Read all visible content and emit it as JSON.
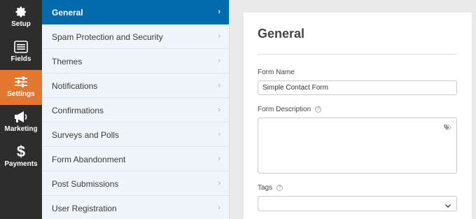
{
  "rail": {
    "items": [
      {
        "label": "Setup",
        "icon": "gear-icon"
      },
      {
        "label": "Fields",
        "icon": "fields-icon"
      },
      {
        "label": "Settings",
        "icon": "sliders-icon",
        "active": true
      },
      {
        "label": "Marketing",
        "icon": "megaphone-icon"
      },
      {
        "label": "Payments",
        "icon": "dollar-icon"
      }
    ]
  },
  "menu": {
    "items": [
      {
        "label": "General",
        "active": true
      },
      {
        "label": "Spam Protection and Security"
      },
      {
        "label": "Themes"
      },
      {
        "label": "Notifications"
      },
      {
        "label": "Confirmations"
      },
      {
        "label": "Surveys and Polls"
      },
      {
        "label": "Form Abandonment"
      },
      {
        "label": "Post Submissions"
      },
      {
        "label": "User Registration"
      }
    ],
    "chevron": "›"
  },
  "panel": {
    "title": "General",
    "form_name": {
      "label": "Form Name",
      "value": "Simple Contact Form"
    },
    "form_description": {
      "label": "Form Description",
      "value": ""
    },
    "tags": {
      "label": "Tags",
      "value": ""
    },
    "help_glyph": "?"
  },
  "colors": {
    "rail_bg": "#2d2d2d",
    "rail_active": "#e27730",
    "menu_bg": "#f0f5fa",
    "menu_active": "#036aab",
    "page_bg": "#e9e9e9"
  }
}
